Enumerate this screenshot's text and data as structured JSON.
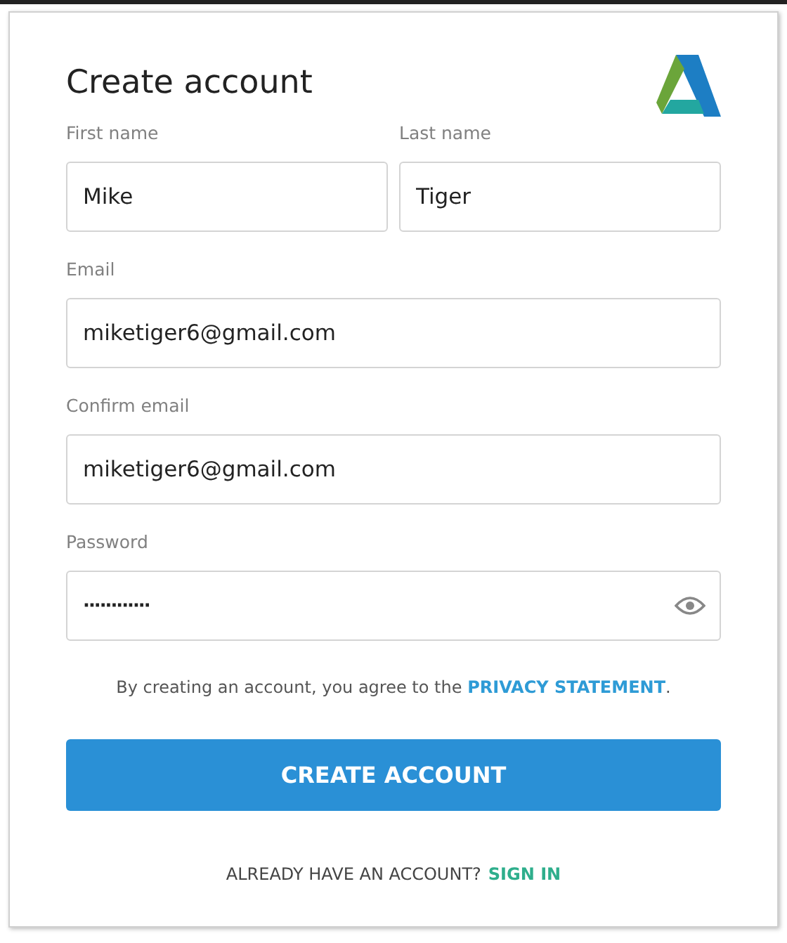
{
  "title": "Create account",
  "name_fields": [
    {
      "label": "First name",
      "value": "Mike"
    },
    {
      "label": "Last name",
      "value": "Tiger"
    }
  ],
  "fields": [
    {
      "label": "Email",
      "value": "miketiger6@gmail.com",
      "kind": "text"
    },
    {
      "label": "Confirm email",
      "value": "miketiger6@gmail.com",
      "kind": "text"
    },
    {
      "label": "Password",
      "value": "············",
      "kind": "password"
    }
  ],
  "agreement": {
    "text": "By creating an account, you agree to the",
    "link": "PRIVACY STATEMENT",
    "end": "."
  },
  "submit_button": "CREATE ACCOUNT",
  "footer": {
    "text": "ALREADY HAVE AN ACCOUNT?",
    "link": "SIGN IN"
  }
}
